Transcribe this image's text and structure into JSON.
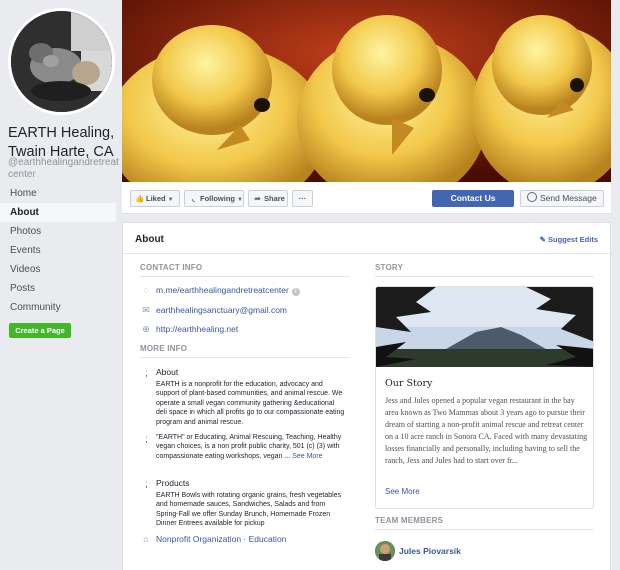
{
  "page": {
    "name": "EARTH Healing, Twain Harte, CA",
    "handle": "@earthhealingandretreatcenter"
  },
  "nav": [
    {
      "label": "Home",
      "active": false
    },
    {
      "label": "About",
      "active": true
    },
    {
      "label": "Photos",
      "active": false
    },
    {
      "label": "Events",
      "active": false
    },
    {
      "label": "Videos",
      "active": false
    },
    {
      "label": "Posts",
      "active": false
    },
    {
      "label": "Community",
      "active": false
    }
  ],
  "create_page_label": "Create a Page",
  "actions": {
    "liked": "Liked",
    "following": "Following",
    "share": "Share",
    "more": "···",
    "contact": "Contact Us",
    "send_message": "Send Message"
  },
  "about": {
    "title": "About",
    "suggest_edits": "Suggest Edits",
    "contact_info_heading": "CONTACT INFO",
    "messenger": "m.me/earthhealingandretreatcenter",
    "email": "earthhealingsanctuary@gmail.com",
    "website": "http://earthhealing.net",
    "more_info_heading": "MORE INFO",
    "about_label": "About",
    "about_text": "EARTH is a nonprofit for the education, advocacy and support of plant-based communities, and animal rescue. We operate a small vegan community gathering &educational deli space in which all profits go to our compassionate eating program and animal rescue.",
    "mission_text": "\"EARTH\" or Educating, Animal Rescuing, Teaching, Healthy vegan choices, is a non profit public charity, 501 (c) (3) with compassionate eating workshops, vegan ...",
    "see_more": "See More",
    "products_label": "Products",
    "products_text": "EARTH Bowls with rotating organic grains, fresh vegetables and homemade sauces, Sandwiches, Salads and from Spring-Fall we offer Sunday Brunch, Homemade Frozen Dinner Entrees available for pickup",
    "category": "Nonprofit Organization · Education"
  },
  "story": {
    "heading": "STORY",
    "title": "Our Story",
    "text": "Jess and Jules opened a popular vegan restaurant in the bay area known as Two Mammas about 3 years ago to pursue their dream of starting a non-profit animal rescue and retreat center on a 10 acre ranch in Sonora CA. Faced with many devastating losses financially and personally, including having to sell the ranch, Jess and Jules had to start over fr...",
    "see_more": "See More"
  },
  "team": {
    "heading": "TEAM MEMBERS",
    "members": [
      {
        "name": "Jules Piovarsik"
      }
    ]
  },
  "colors": {
    "brand_blue": "#4267b2",
    "link_blue": "#385898",
    "green": "#42b72a",
    "background": "#e9ebee"
  },
  "icons": [
    "messenger-icon",
    "envelope-icon",
    "globe-icon",
    "info-icon",
    "tag-icon",
    "thumbs-up-icon",
    "rss-icon",
    "share-arrow-icon",
    "pencil-icon"
  ]
}
